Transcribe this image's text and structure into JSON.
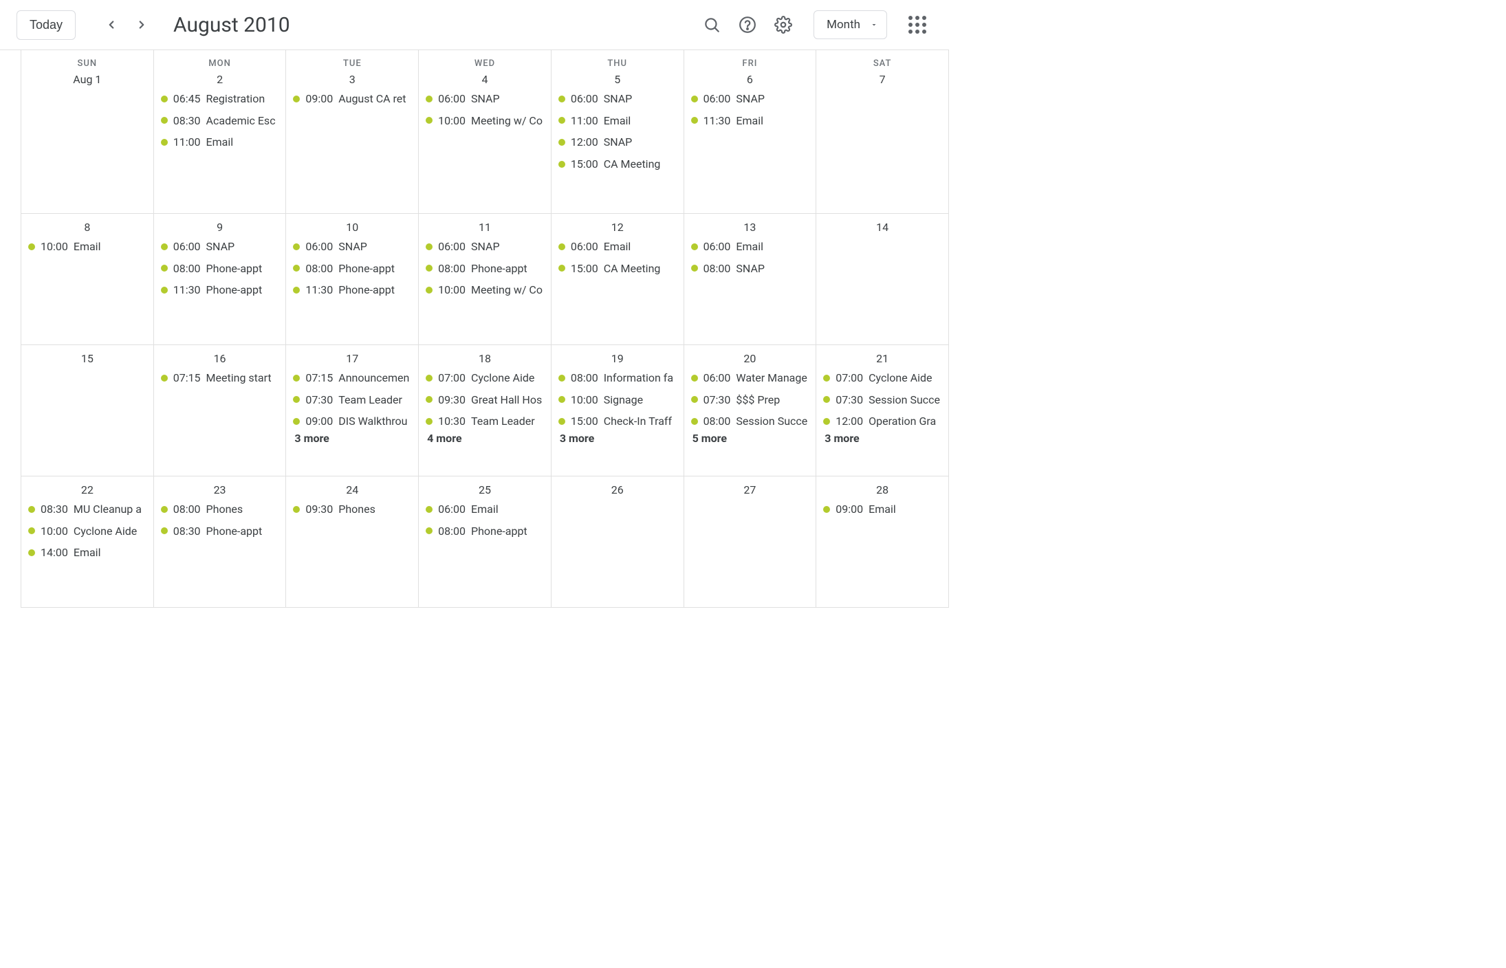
{
  "toolbar": {
    "today_label": "Today",
    "title": "August 2010",
    "view_label": "Month"
  },
  "weekdays": [
    "SUN",
    "MON",
    "TUE",
    "WED",
    "THU",
    "FRI",
    "SAT"
  ],
  "weeks": [
    [
      {
        "label": "Aug 1",
        "events": []
      },
      {
        "label": "2",
        "events": [
          {
            "time": "06:45",
            "title": "Registration"
          },
          {
            "time": "08:30",
            "title": "Academic Esc"
          },
          {
            "time": "11:00",
            "title": "Email"
          }
        ]
      },
      {
        "label": "3",
        "events": [
          {
            "time": "09:00",
            "title": "August CA ret"
          }
        ]
      },
      {
        "label": "4",
        "events": [
          {
            "time": "06:00",
            "title": "SNAP"
          },
          {
            "time": "10:00",
            "title": "Meeting w/ Co"
          }
        ]
      },
      {
        "label": "5",
        "events": [
          {
            "time": "06:00",
            "title": "SNAP"
          },
          {
            "time": "11:00",
            "title": "Email"
          },
          {
            "time": "12:00",
            "title": "SNAP"
          },
          {
            "time": "15:00",
            "title": "CA Meeting"
          }
        ]
      },
      {
        "label": "6",
        "events": [
          {
            "time": "06:00",
            "title": "SNAP"
          },
          {
            "time": "11:30",
            "title": "Email"
          }
        ]
      },
      {
        "label": "7",
        "events": []
      }
    ],
    [
      {
        "label": "8",
        "events": [
          {
            "time": "10:00",
            "title": "Email"
          }
        ]
      },
      {
        "label": "9",
        "events": [
          {
            "time": "06:00",
            "title": "SNAP"
          },
          {
            "time": "08:00",
            "title": "Phone-appt"
          },
          {
            "time": "11:30",
            "title": "Phone-appt"
          }
        ]
      },
      {
        "label": "10",
        "events": [
          {
            "time": "06:00",
            "title": "SNAP"
          },
          {
            "time": "08:00",
            "title": "Phone-appt"
          },
          {
            "time": "11:30",
            "title": "Phone-appt"
          }
        ]
      },
      {
        "label": "11",
        "events": [
          {
            "time": "06:00",
            "title": "SNAP"
          },
          {
            "time": "08:00",
            "title": "Phone-appt"
          },
          {
            "time": "10:00",
            "title": "Meeting w/ Co"
          }
        ]
      },
      {
        "label": "12",
        "events": [
          {
            "time": "06:00",
            "title": "Email"
          },
          {
            "time": "15:00",
            "title": "CA Meeting"
          }
        ]
      },
      {
        "label": "13",
        "events": [
          {
            "time": "06:00",
            "title": "Email"
          },
          {
            "time": "08:00",
            "title": "SNAP"
          }
        ]
      },
      {
        "label": "14",
        "events": []
      }
    ],
    [
      {
        "label": "15",
        "events": []
      },
      {
        "label": "16",
        "events": [
          {
            "time": "07:15",
            "title": "Meeting start"
          }
        ]
      },
      {
        "label": "17",
        "events": [
          {
            "time": "07:15",
            "title": "Announcemen"
          },
          {
            "time": "07:30",
            "title": "Team Leader"
          },
          {
            "time": "09:00",
            "title": "DIS Walkthrou"
          }
        ],
        "more": "3 more"
      },
      {
        "label": "18",
        "events": [
          {
            "time": "07:00",
            "title": "Cyclone Aide"
          },
          {
            "time": "09:30",
            "title": "Great Hall Hos"
          },
          {
            "time": "10:30",
            "title": "Team Leader"
          }
        ],
        "more": "4 more"
      },
      {
        "label": "19",
        "events": [
          {
            "time": "08:00",
            "title": "Information fa"
          },
          {
            "time": "10:00",
            "title": "Signage"
          },
          {
            "time": "15:00",
            "title": "Check-In Traff"
          }
        ],
        "more": "3 more"
      },
      {
        "label": "20",
        "events": [
          {
            "time": "06:00",
            "title": "Water Manage"
          },
          {
            "time": "07:30",
            "title": "$$$ Prep"
          },
          {
            "time": "08:00",
            "title": "Session Succe"
          }
        ],
        "more": "5 more"
      },
      {
        "label": "21",
        "events": [
          {
            "time": "07:00",
            "title": "Cyclone Aide"
          },
          {
            "time": "07:30",
            "title": "Session Succe"
          },
          {
            "time": "12:00",
            "title": "Operation Gra"
          }
        ],
        "more": "3 more"
      }
    ],
    [
      {
        "label": "22",
        "events": [
          {
            "time": "08:30",
            "title": "MU Cleanup a"
          },
          {
            "time": "10:00",
            "title": "Cyclone Aide"
          },
          {
            "time": "14:00",
            "title": "Email"
          }
        ]
      },
      {
        "label": "23",
        "events": [
          {
            "time": "08:00",
            "title": "Phones"
          },
          {
            "time": "08:30",
            "title": "Phone-appt"
          }
        ]
      },
      {
        "label": "24",
        "events": [
          {
            "time": "09:30",
            "title": "Phones"
          }
        ]
      },
      {
        "label": "25",
        "events": [
          {
            "time": "06:00",
            "title": "Email"
          },
          {
            "time": "08:00",
            "title": "Phone-appt"
          }
        ]
      },
      {
        "label": "26",
        "events": []
      },
      {
        "label": "27",
        "events": []
      },
      {
        "label": "28",
        "events": [
          {
            "time": "09:00",
            "title": "Email"
          }
        ]
      }
    ]
  ]
}
